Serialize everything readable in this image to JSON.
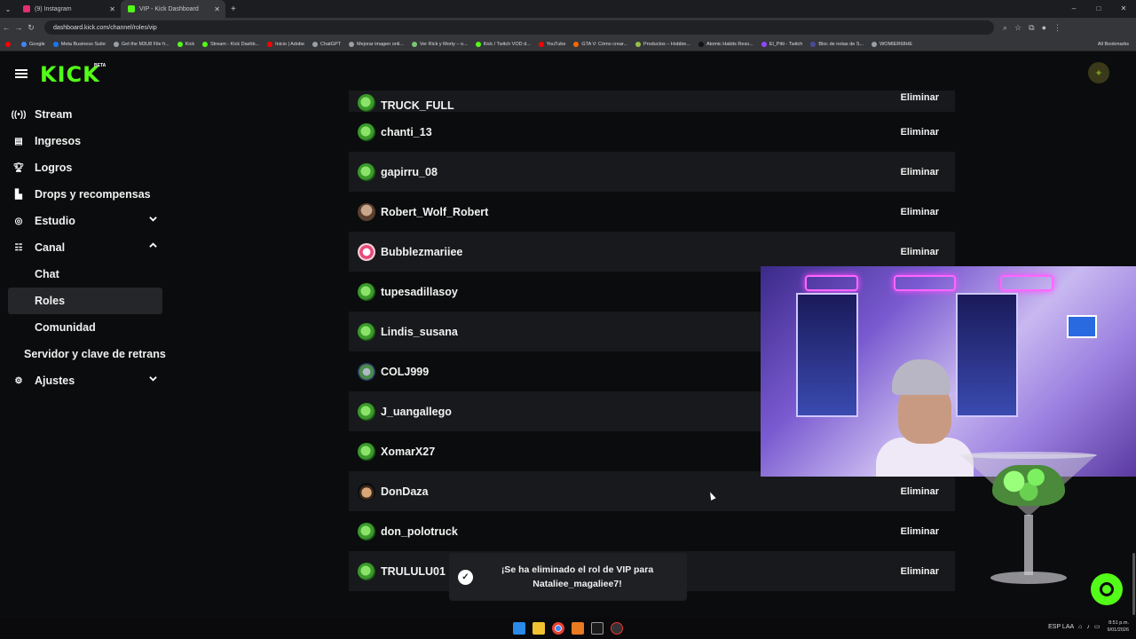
{
  "browser": {
    "tabs": [
      {
        "title": "(9) Instagram",
        "icon_color": "#e1306c"
      },
      {
        "title": "VIP - Kick Dashboard",
        "icon_color": "#53fc18"
      }
    ],
    "url": "dashboard.kick.com/channel/roles/vip",
    "bookmarks": [
      {
        "label": "",
        "color": "#ff0000"
      },
      {
        "label": "Google",
        "color": "#4285f4"
      },
      {
        "label": "Meta Business Suite",
        "color": "#1877f2"
      },
      {
        "label": "Get the M3U8 File fr...",
        "color": "#9aa0a6"
      },
      {
        "label": "Kick",
        "color": "#53fc18"
      },
      {
        "label": "Stream - Kick Dashb...",
        "color": "#53fc18"
      },
      {
        "label": "Inicio | Adobe",
        "color": "#ff0000"
      },
      {
        "label": "ChatGPT",
        "color": "#9aa0a6"
      },
      {
        "label": "Mejorar imagen onli...",
        "color": "#9aa0a6"
      },
      {
        "label": "Ver Rick y Morty – o...",
        "color": "#7cc576"
      },
      {
        "label": "Kick / Twitch VOD d...",
        "color": "#53fc18"
      },
      {
        "label": "YouTube",
        "color": "#ff0000"
      },
      {
        "label": "GTA V: Cómo crear...",
        "color": "#ff6600"
      },
      {
        "label": "Productos – Hobbie...",
        "color": "#96bf48"
      },
      {
        "label": "Atomic Habits Reso...",
        "color": "#111111"
      },
      {
        "label": "El_Pitti - Twitch",
        "color": "#9146ff"
      },
      {
        "label": "Bloc de notas de S...",
        "color": "#4a4a9a"
      },
      {
        "label": "WOMIER68HE",
        "color": "#9aa0a6"
      }
    ],
    "all_bookmarks": "All Bookmarks"
  },
  "app": {
    "logo": "KICK",
    "beta": "BETA"
  },
  "sidebar": {
    "items": [
      {
        "label": "Stream",
        "icon": "broadcast-icon"
      },
      {
        "label": "Ingresos",
        "icon": "chart-icon"
      },
      {
        "label": "Logros",
        "icon": "trophy-icon"
      },
      {
        "label": "Drops y recompensas",
        "icon": "drops-icon"
      },
      {
        "label": "Estudio",
        "icon": "studio-icon"
      },
      {
        "label": "Canal",
        "icon": "channel-icon"
      },
      {
        "label": "Chat"
      },
      {
        "label": "Roles"
      },
      {
        "label": "Comunidad"
      },
      {
        "label": "Servidor y clave de retrans"
      },
      {
        "label": "Ajustes",
        "icon": "gear-icon"
      }
    ]
  },
  "vip_list": {
    "remove_label": "Eliminar",
    "rows": [
      {
        "username": "TRUCK_FULL",
        "avatar": "green"
      },
      {
        "username": "chanti_13",
        "avatar": "green"
      },
      {
        "username": "gapirru_08",
        "avatar": "green"
      },
      {
        "username": "Robert_Wolf_Robert",
        "avatar": "brown"
      },
      {
        "username": "Bubblezmariiee",
        "avatar": "pink"
      },
      {
        "username": "tupesadillasoy",
        "avatar": "green"
      },
      {
        "username": "Lindis_susana",
        "avatar": "green"
      },
      {
        "username": "COLJ999",
        "avatar": "mix"
      },
      {
        "username": "J_uangallego",
        "avatar": "green"
      },
      {
        "username": "XomarX27",
        "avatar": "green"
      },
      {
        "username": "DonDaza",
        "avatar": "face"
      },
      {
        "username": "don_polotruck",
        "avatar": "green"
      },
      {
        "username": "TRULULU01",
        "avatar": "green"
      }
    ]
  },
  "toast": {
    "line1": "¡Se ha eliminado el rol de VIP para",
    "line2": "Nataliee_magaliee7!"
  },
  "taskbar": {
    "time": "8:51 p.m.",
    "date": "9/01/2026",
    "lang": "ESP LAA"
  }
}
